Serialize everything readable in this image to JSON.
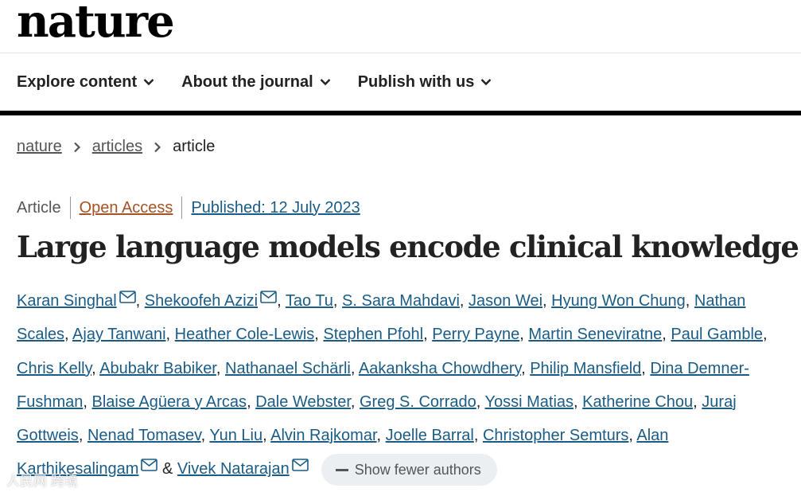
{
  "header": {
    "logo": "nature",
    "nav": [
      {
        "label": "Explore content"
      },
      {
        "label": "About the journal"
      },
      {
        "label": "Publish with us"
      }
    ]
  },
  "breadcrumb": {
    "items": [
      "nature",
      "articles"
    ],
    "current": "article"
  },
  "meta": {
    "type": "Article",
    "access": "Open Access",
    "published": "Published: 12 July 2023"
  },
  "title": "Large language models encode clinical knowledge",
  "authors": {
    "list": [
      {
        "name": "Karan Singhal",
        "mail": true,
        "sep": ", "
      },
      {
        "name": "Shekoofeh Azizi",
        "mail": true,
        "sep": ", "
      },
      {
        "name": "Tao Tu",
        "sep": ", "
      },
      {
        "name": "S. Sara Mahdavi",
        "sep": ", "
      },
      {
        "name": "Jason Wei",
        "sep": ", "
      },
      {
        "name": "Hyung Won Chung",
        "sep": ", "
      },
      {
        "name": "Nathan Scales",
        "sep": ", "
      },
      {
        "name": "Ajay Tanwani",
        "sep": ", "
      },
      {
        "name": "Heather Cole-Lewis",
        "sep": ", "
      },
      {
        "name": "Stephen Pfohl",
        "sep": ", "
      },
      {
        "name": "Perry Payne",
        "sep": ", "
      },
      {
        "name": "Martin Seneviratne",
        "sep": ", "
      },
      {
        "name": "Paul Gamble",
        "sep": ", "
      },
      {
        "name": "Chris Kelly",
        "sep": ", "
      },
      {
        "name": "Abubakr Babiker",
        "sep": ", "
      },
      {
        "name": "Nathanael Schärli",
        "sep": ", "
      },
      {
        "name": "Aakanksha Chowdhery",
        "sep": ", "
      },
      {
        "name": "Philip Mansfield",
        "sep": ", "
      },
      {
        "name": "Dina Demner-Fushman",
        "sep": ", "
      },
      {
        "name": "Blaise Agüera y Arcas",
        "sep": ", "
      },
      {
        "name": "Dale Webster",
        "sep": ", "
      },
      {
        "name": "Greg S. Corrado",
        "sep": ", "
      },
      {
        "name": "Yossi Matias",
        "sep": ", "
      },
      {
        "name": "Katherine Chou",
        "sep": ", "
      },
      {
        "name": "Juraj Gottweis",
        "sep": ", "
      },
      {
        "name": "Nenad Tomasev",
        "sep": ", "
      },
      {
        "name": "Yun Liu",
        "sep": ", "
      },
      {
        "name": "Alvin Rajkomar",
        "sep": ", "
      },
      {
        "name": "Joelle Barral",
        "sep": ", "
      },
      {
        "name": "Christopher Semturs",
        "sep": ", "
      },
      {
        "name": "Alan Karthikesalingam",
        "mail": true,
        "sep": " & "
      },
      {
        "name": "Vivek Natarajan",
        "mail": true,
        "sep": ""
      }
    ],
    "toggle_label": "Show fewer authors"
  },
  "watermark": "人民网 跨境",
  "colors": {
    "link": "#1a5c86",
    "open_access": "#a55226",
    "text": "#222222",
    "muted": "#555555",
    "button_bg": "#eceff1"
  }
}
